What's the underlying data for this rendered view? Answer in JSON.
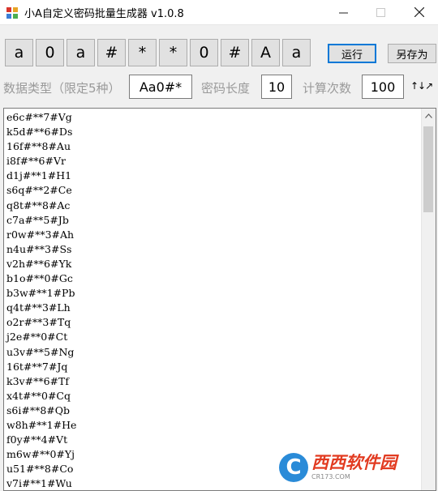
{
  "window": {
    "title": "小A自定义密码批量生成器 v1.0.8"
  },
  "char_buttons": [
    "a",
    "0",
    "a",
    "#",
    "*",
    "*",
    "0",
    "#",
    "A",
    "a"
  ],
  "actions": {
    "run_label": "运行",
    "save_as_label": "另存为"
  },
  "settings": {
    "data_type_label": "数据类型（限定5种）",
    "data_type_value": "Aa0#*",
    "length_label": "密码长度",
    "length_value": "10",
    "count_label": "计算次数",
    "count_value": "100",
    "sort_label": "↑↓↗"
  },
  "output_lines": [
    "e6c#**7#Vg",
    "k5d#**6#Ds",
    "16f#**8#Au",
    "i8f#**6#Vr",
    "d1j#**1#H1",
    "s6q#**2#Ce",
    "q8t#**8#Ac",
    "c7a#**5#Jb",
    "r0w#**3#Ah",
    "n4u#**3#Ss",
    "v2h#**6#Yk",
    "b1o#**0#Gc",
    "b3w#**1#Pb",
    "q4t#**3#Lh",
    "o2r#**3#Tq",
    "j2e#**0#Ct",
    "u3v#**5#Ng",
    "16t#**7#Jq",
    "k3v#**6#Tf",
    "x4t#**0#Cq",
    "s6i#**8#Qb",
    "w8h#**1#He",
    "f0y#**4#Vt",
    "m6w#**0#Yj",
    "u51#**8#Co",
    "v7i#**1#Wu"
  ],
  "watermark": {
    "brand": "西西软件园",
    "url": "CR173.COM"
  }
}
